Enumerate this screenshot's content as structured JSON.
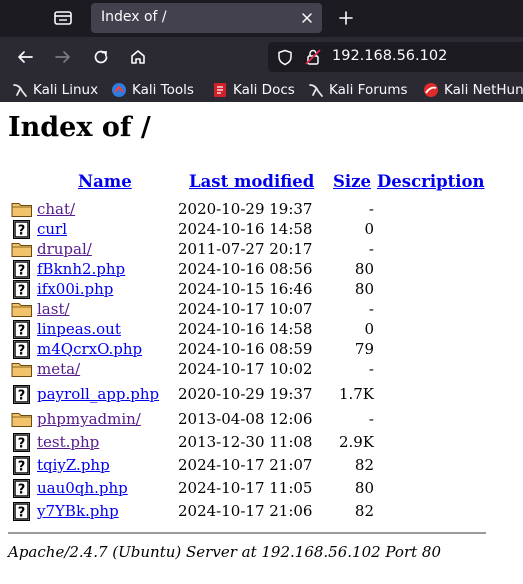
{
  "browser": {
    "tab": {
      "title": "Index of /"
    },
    "url": "192.168.56.102",
    "bookmarks": [
      {
        "label": "Kali Linux",
        "icon": "kali-dragon-icon"
      },
      {
        "label": "Kali Tools",
        "icon": "kali-tools-icon"
      },
      {
        "label": "Kali Docs",
        "icon": "kali-docs-icon"
      },
      {
        "label": "Kali Forums",
        "icon": "kali-dragon-icon"
      },
      {
        "label": "Kali NetHunter",
        "icon": "nethunter-icon"
      }
    ]
  },
  "page": {
    "title": "Index of /",
    "columns": {
      "name": "Name",
      "last_modified": "Last modified",
      "size": "Size",
      "description": "Description"
    },
    "entries": [
      {
        "name": "chat/",
        "date": "2020-10-29 19:37",
        "size": "-",
        "type": "folder-icon",
        "visited": true
      },
      {
        "name": "curl",
        "date": "2024-10-16 14:58",
        "size": "0",
        "type": "unknown-file-icon",
        "visited": false
      },
      {
        "name": "drupal/",
        "date": "2011-07-27 20:17",
        "size": "-",
        "type": "folder-icon",
        "visited": true
      },
      {
        "name": "fBknh2.php",
        "date": "2024-10-16 08:56",
        "size": "80",
        "type": "unknown-file-icon",
        "visited": false
      },
      {
        "name": "ifx00i.php",
        "date": "2024-10-15 16:46",
        "size": "80",
        "type": "unknown-file-icon",
        "visited": false
      },
      {
        "name": "last/",
        "date": "2024-10-17 10:07",
        "size": "-",
        "type": "folder-icon",
        "visited": true
      },
      {
        "name": "linpeas.out",
        "date": "2024-10-16 14:58",
        "size": "0",
        "type": "unknown-file-icon",
        "visited": false
      },
      {
        "name": "m4QcrxO.php",
        "date": "2024-10-16 08:59",
        "size": "79",
        "type": "unknown-file-icon",
        "visited": false
      },
      {
        "name": "meta/",
        "date": "2024-10-17 10:02",
        "size": "-",
        "type": "folder-icon",
        "visited": true
      },
      {
        "name": "payroll_app.php",
        "date": "2020-10-29 19:37",
        "size": "1.7K",
        "type": "unknown-file-icon",
        "visited": false
      },
      {
        "name": "phpmyadmin/",
        "date": "2013-04-08 12:06",
        "size": "-",
        "type": "folder-icon",
        "visited": true
      },
      {
        "name": "test.php",
        "date": "2013-12-30 11:08",
        "size": "2.9K",
        "type": "unknown-file-icon",
        "visited": true
      },
      {
        "name": "tqiyZ.php",
        "date": "2024-10-17 21:07",
        "size": "82",
        "type": "unknown-file-icon",
        "visited": false
      },
      {
        "name": "uau0qh.php",
        "date": "2024-10-17 11:05",
        "size": "80",
        "type": "unknown-file-icon",
        "visited": false
      },
      {
        "name": "y7YBk.php",
        "date": "2024-10-17 21:06",
        "size": "82",
        "type": "unknown-file-icon",
        "visited": false
      }
    ],
    "footer": "Apache/2.4.7 (Ubuntu) Server at 192.168.56.102 Port 80"
  },
  "colors": {
    "link": "#0000ee",
    "visited": "#551a8b",
    "folder": "#f2c36b",
    "chrome_dark": "#1c1b22",
    "chrome": "#2b2a33"
  }
}
